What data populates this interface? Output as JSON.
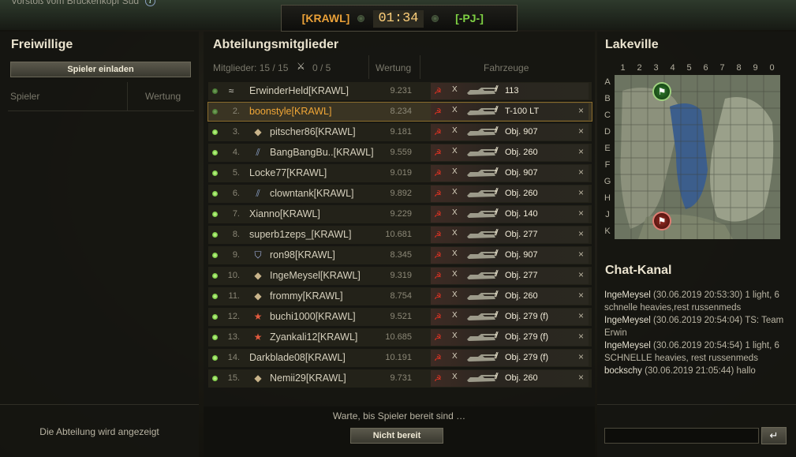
{
  "top": {
    "map_desc": "Vorstoß vom Brückenkopf Süd",
    "team_left": "[KRAWL]",
    "timer": "01:34",
    "team_right": "[-PJ-]"
  },
  "volunteers": {
    "title": "Freiwillige",
    "invite_button": "Spieler einladen",
    "col_player": "Spieler",
    "col_rating": "Wertung",
    "footer": "Die Abteilung wird angezeigt"
  },
  "members": {
    "title": "Abteilungsmitglieder",
    "count_label": "Mitglieder: 15 / 15",
    "legionaries": "0 / 5",
    "col_rating": "Wertung",
    "col_vehicles": "Fahrzeuge",
    "rows": [
      {
        "num": "",
        "name": "ErwinderHeld[KRAWL]",
        "rating": "9.231",
        "vehicle": "113",
        "cls": "",
        "ready": false,
        "selected": false,
        "badge": "wings",
        "kick": ""
      },
      {
        "num": "2.",
        "name": "boonstyle[KRAWL]",
        "rating": "8.234",
        "vehicle": "T-100 LT",
        "cls": "♦",
        "ready": false,
        "selected": true,
        "badge": "",
        "kick": "×"
      },
      {
        "num": "3.",
        "name": "pitscher86[KRAWL]",
        "rating": "9.181",
        "vehicle": "Obj. 907",
        "cls": "",
        "ready": true,
        "selected": false,
        "badge": "diamond",
        "kick": "×"
      },
      {
        "num": "4.",
        "name": "BangBangBu..[KRAWL]",
        "rating": "9.559",
        "vehicle": "Obj. 260",
        "cls": "",
        "ready": true,
        "selected": false,
        "badge": "stripes",
        "kick": "×"
      },
      {
        "num": "5.",
        "name": "Locke77[KRAWL]",
        "rating": "9.019",
        "vehicle": "Obj. 907",
        "cls": "",
        "ready": true,
        "selected": false,
        "badge": "",
        "kick": "×"
      },
      {
        "num": "6.",
        "name": "clowntank[KRAWL]",
        "rating": "9.892",
        "vehicle": "Obj. 260",
        "cls": "",
        "ready": true,
        "selected": false,
        "badge": "stripes",
        "kick": "×"
      },
      {
        "num": "7.",
        "name": "Xianno[KRAWL]",
        "rating": "9.229",
        "vehicle": "Obj. 140",
        "cls": "",
        "ready": true,
        "selected": false,
        "badge": "",
        "kick": "×"
      },
      {
        "num": "8.",
        "name": "superb1zeps_[KRAWL]",
        "rating": "10.681",
        "vehicle": "Obj. 277",
        "cls": "",
        "ready": true,
        "selected": false,
        "badge": "",
        "kick": "×"
      },
      {
        "num": "9.",
        "name": "ron98[KRAWL]",
        "rating": "8.345",
        "vehicle": "Obj. 907",
        "cls": "",
        "ready": true,
        "selected": false,
        "badge": "shield",
        "kick": "×"
      },
      {
        "num": "10.",
        "name": "IngeMeysel[KRAWL]",
        "rating": "9.319",
        "vehicle": "Obj. 277",
        "cls": "",
        "ready": true,
        "selected": false,
        "badge": "diamond",
        "kick": "×"
      },
      {
        "num": "11.",
        "name": "frommy[KRAWL]",
        "rating": "8.754",
        "vehicle": "Obj. 260",
        "cls": "",
        "ready": true,
        "selected": false,
        "badge": "diamond",
        "kick": "×"
      },
      {
        "num": "12.",
        "name": "buchi1000[KRAWL]",
        "rating": "9.521",
        "vehicle": "Obj. 279 (f)",
        "cls": "",
        "ready": true,
        "selected": false,
        "badge": "star",
        "kick": "×"
      },
      {
        "num": "13.",
        "name": "Zyankali12[KRAWL]",
        "rating": "10.685",
        "vehicle": "Obj. 279 (f)",
        "cls": "",
        "ready": true,
        "selected": false,
        "badge": "star",
        "kick": "×"
      },
      {
        "num": "14.",
        "name": "Darkblade08[KRAWL]",
        "rating": "10.191",
        "vehicle": "Obj. 279 (f)",
        "cls": "",
        "ready": true,
        "selected": false,
        "badge": "",
        "kick": "×"
      },
      {
        "num": "15.",
        "name": "Nemii29[KRAWL]",
        "rating": "9.731",
        "vehicle": "Obj. 260",
        "cls": "",
        "ready": true,
        "selected": false,
        "badge": "diamond",
        "kick": "×"
      }
    ],
    "waiting_text": "Warte, bis Spieler bereit sind …",
    "not_ready_button": "Nicht bereit"
  },
  "map": {
    "title": "Lakeville",
    "cols": [
      "1",
      "2",
      "3",
      "4",
      "5",
      "6",
      "7",
      "8",
      "9",
      "0"
    ],
    "rows": [
      "A",
      "B",
      "C",
      "D",
      "E",
      "F",
      "G",
      "H",
      "J",
      "K"
    ]
  },
  "chat": {
    "title": "Chat-Kanal",
    "messages": [
      {
        "sender": "IngeMeysel",
        "time": "(30.06.2019 20:53:30)",
        "text": "1 light, 6 schnelle heavies,rest russenmeds"
      },
      {
        "sender": "IngeMeysel",
        "time": "(30.06.2019 20:54:04)",
        "text": "TS: Team Erwin"
      },
      {
        "sender": "IngeMeysel",
        "time": "(30.06.2019 20:54:54)",
        "text": "1 light, 6 SCHNELLE heavies, rest russenmeds"
      },
      {
        "sender": "bockschy",
        "time": "(30.06.2019 21:05:44)",
        "text": "hallo"
      }
    ],
    "send_icon": "↵"
  },
  "colors": {
    "accent_orange": "#e9a038",
    "accent_green": "#7ed043",
    "soviet_red": "#e23222"
  }
}
